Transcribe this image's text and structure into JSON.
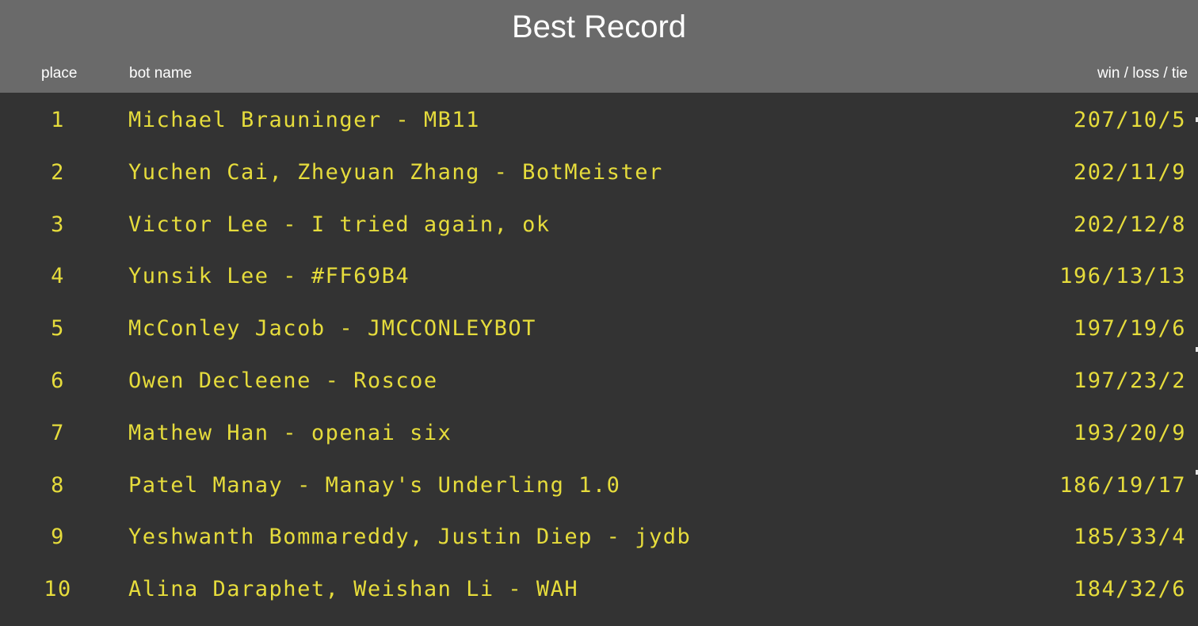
{
  "title": "Best Record",
  "columns": {
    "place": "place",
    "bot_name": "bot name",
    "record": "win / loss / tie"
  },
  "rows": [
    {
      "place": "1",
      "bot_name": "Michael Brauninger - MB11",
      "record": "207/10/5"
    },
    {
      "place": "2",
      "bot_name": "Yuchen Cai, Zheyuan Zhang - BotMeister",
      "record": "202/11/9"
    },
    {
      "place": "3",
      "bot_name": "Victor Lee - I tried again, ok",
      "record": "202/12/8"
    },
    {
      "place": "4",
      "bot_name": "Yunsik Lee - #FF69B4",
      "record": "196/13/13"
    },
    {
      "place": "5",
      "bot_name": "McConley Jacob - JMCCONLEYBOT",
      "record": "197/19/6"
    },
    {
      "place": "6",
      "bot_name": "Owen Decleene - Roscoe",
      "record": "197/23/2"
    },
    {
      "place": "7",
      "bot_name": "Mathew Han - openai six",
      "record": "193/20/9"
    },
    {
      "place": "8",
      "bot_name": "Patel Manay - Manay's Underling 1.0",
      "record": "186/19/17"
    },
    {
      "place": "9",
      "bot_name": "Yeshwanth Bommareddy, Justin Diep - jydb",
      "record": "185/33/4"
    },
    {
      "place": "10",
      "bot_name": "Alina Daraphet, Weishan Li - WAH",
      "record": "184/32/6"
    }
  ],
  "colors": {
    "header_bg": "#6a6a6a",
    "body_bg": "#333333",
    "row_text": "#e6dc3c",
    "header_text": "#ffffff"
  }
}
